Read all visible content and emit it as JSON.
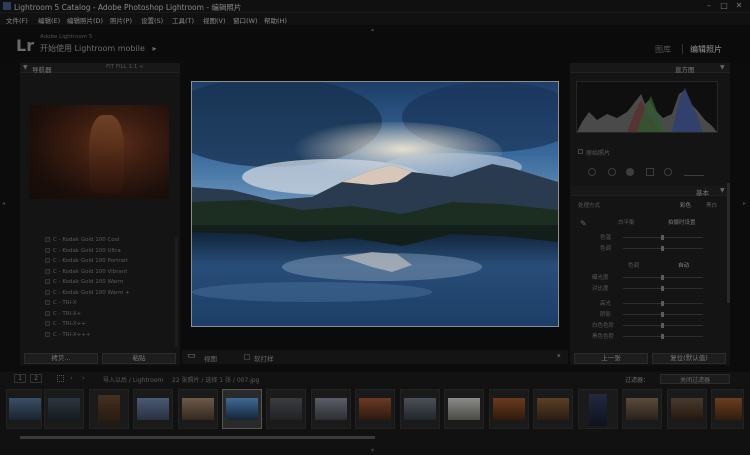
{
  "window": {
    "title": "Lightroom 5 Catalog - Adobe Photoshop Lightroom - 编辑照片",
    "controls": [
      "–",
      "□",
      "✕"
    ]
  },
  "menubar": [
    "文件(F)",
    "编辑(E)",
    "编辑照片(D)",
    "照片(P)",
    "设置(S)",
    "工具(T)",
    "视图(V)",
    "窗口(W)",
    "帮助(H)"
  ],
  "identity": {
    "logo": "Lr",
    "line1": "Adobe Lightroom 5",
    "line2": "开始使用 Lightroom mobile",
    "arrow": "▸"
  },
  "modules": {
    "library": "图库",
    "develop": "编辑照片"
  },
  "left_panel": {
    "navigator_label": "导航器",
    "nav_controls": "FIT  FILL  1:1  ÷",
    "presets": [
      "C - Kodak Gold 100 Cool",
      "C - Kodak Gold 100 Ultra",
      "C - Kodak Gold 100 Portrait",
      "C - Kodak Gold 100 Vibrant",
      "C - Kodak Gold 100 Warm",
      "C - Kodak Gold 100 Warm +",
      "C - TRI-X",
      "C - TRI-X+",
      "C - TRI-X++",
      "C - TRI-X+++"
    ],
    "copy_button": "拷贝...",
    "paste_button": "粘贴"
  },
  "toolbar": {
    "view_mode": "▭",
    "soft_proof_label": "视图",
    "compare_label": "软打样",
    "dropdown": "▾"
  },
  "right_panel": {
    "histogram_label": "直方图",
    "original_label": "原始照片",
    "basic_label": "基本",
    "treatment_label": "处理方式",
    "color_option": "彩色",
    "bw_option": "黑白",
    "wb_label": "白平衡",
    "wb_value": "拍摄时设置",
    "temp_label": "色温",
    "tint_label": "色调",
    "tone_label": "色调",
    "auto_label": "自动",
    "exposure_label": "曝光度",
    "contrast_label": "对比度",
    "highlights_label": "高光",
    "shadows_label": "阴影",
    "whites_label": "白色色阶",
    "blacks_label": "黑色色阶",
    "prev_button": "上一张",
    "reset_button": "复位(默认值)"
  },
  "filmstrip_bar": {
    "page1": "1",
    "page2": "2",
    "path": "导入以后 / Lightroom",
    "count": "22 张照片 / 选择 1 张 / 007.jpg",
    "filter_label": "过滤器：",
    "filter_value": "关闭过滤器"
  },
  "colors": {
    "accent": "#5f84c4",
    "background": "#0c0c0c",
    "panel": "#141414"
  }
}
